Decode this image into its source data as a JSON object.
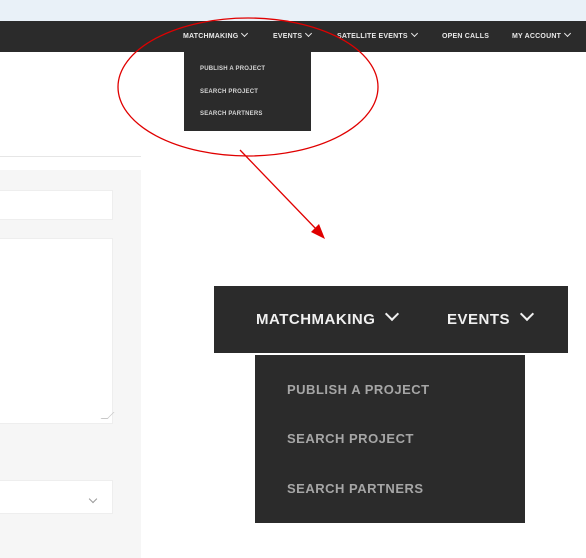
{
  "nav": {
    "items": [
      {
        "label": "MATCHMAKING",
        "dropdown": true
      },
      {
        "label": "EVENTS",
        "dropdown": true
      },
      {
        "label": "SATELLITE EVENTS",
        "dropdown": true
      },
      {
        "label": "OPEN CALLS",
        "dropdown": false
      },
      {
        "label": "MY ACCOUNT",
        "dropdown": true
      }
    ]
  },
  "matchmaking_menu": {
    "items": [
      "PUBLISH A PROJECT",
      "SEARCH PROJECT",
      "SEARCH PARTNERS"
    ]
  },
  "zoom": {
    "nav": [
      "MATCHMAKING",
      "EVENTS"
    ],
    "menu": [
      "PUBLISH A PROJECT",
      "SEARCH PROJECT",
      "SEARCH PARTNERS"
    ]
  },
  "colors": {
    "navbar": "#2b2b2b",
    "annotation": "#e00000"
  },
  "icons": [
    "chevron-down-icon",
    "resize-grip-icon"
  ]
}
